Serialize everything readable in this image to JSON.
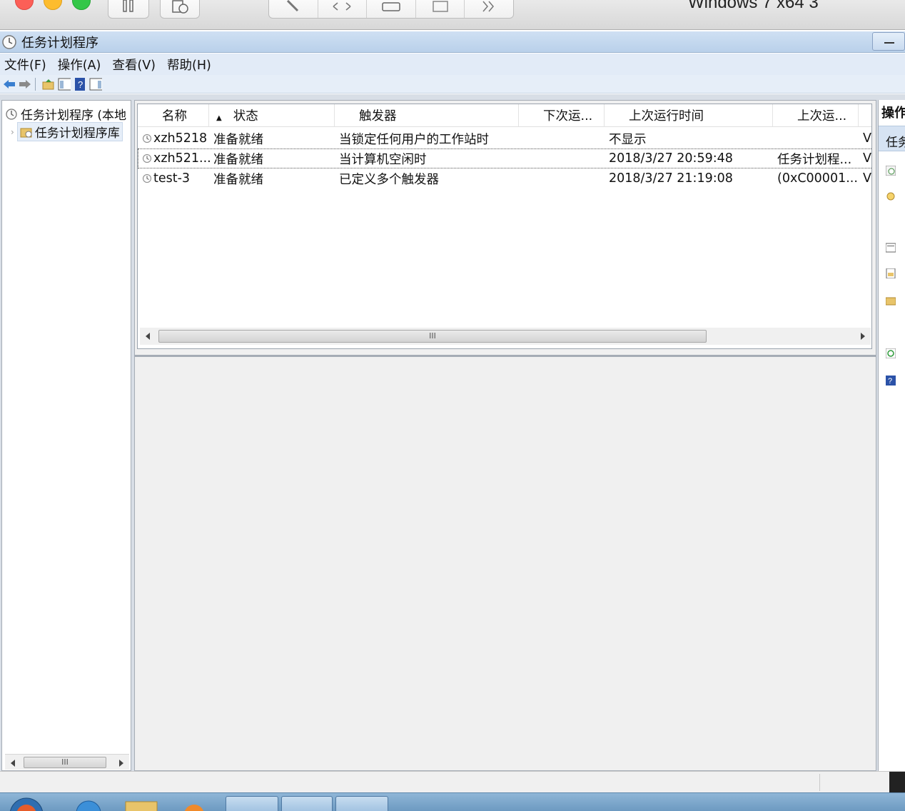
{
  "host": {
    "vm_title": "Windows 7 x64 3"
  },
  "window": {
    "title": "任务计划程序"
  },
  "menu": {
    "items": [
      "文件(F)",
      "操作(A)",
      "查看(V)",
      "帮助(H)"
    ]
  },
  "tree": {
    "root_label": "任务计划程序 (本地",
    "child_label": "任务计划程序库"
  },
  "list": {
    "columns": [
      "名称",
      "状态",
      "触发器",
      "下次运...",
      "上次运行时间",
      "上次运..."
    ],
    "rows": [
      {
        "name": "xzh5218",
        "status": "准备就绪",
        "trigger": "当锁定任何用户的工作站时",
        "next_run": "",
        "last_run": "不显示",
        "last_result": "",
        "author": "V"
      },
      {
        "name": "xzh521...",
        "status": "准备就绪",
        "trigger": "当计算机空闲时",
        "next_run": "",
        "last_run": "2018/3/27 20:59:48",
        "last_result": "任务计划程...",
        "author": "V"
      },
      {
        "name": "test-3",
        "status": "准备就绪",
        "trigger": "已定义多个触发器",
        "next_run": "",
        "last_run": "2018/3/27 21:19:08",
        "last_result": "(0xC00001...",
        "author": "V"
      }
    ],
    "scroll_grip": "III"
  },
  "actions": {
    "header": "操作",
    "section": "任务"
  },
  "colors": {
    "title_bar": "#b9d0ea",
    "menu_bar": "#e2ebf7",
    "selected_tree": "#e6eef8"
  }
}
